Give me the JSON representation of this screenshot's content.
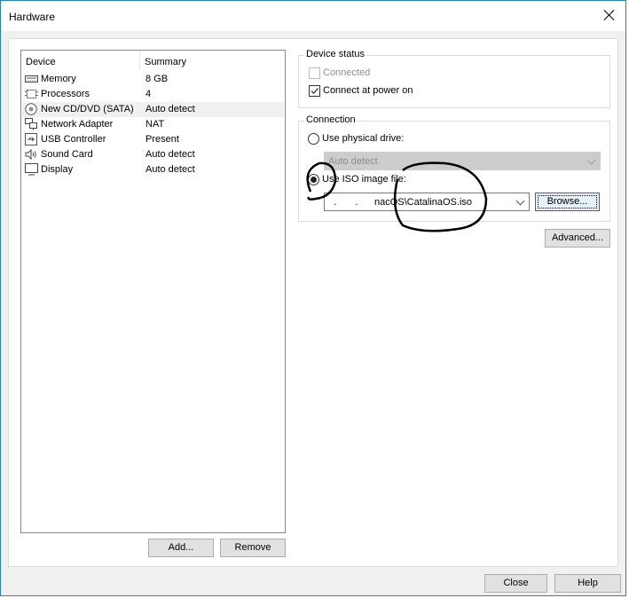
{
  "window": {
    "title": "Hardware"
  },
  "device_list": {
    "columns": [
      "Device",
      "Summary"
    ],
    "rows": [
      {
        "icon": "memory-icon",
        "name": "Memory",
        "summary": "8 GB",
        "selected": false
      },
      {
        "icon": "processor-icon",
        "name": "Processors",
        "summary": "4",
        "selected": false
      },
      {
        "icon": "cd-dvd-icon",
        "name": "New CD/DVD (SATA)",
        "summary": "Auto detect",
        "selected": true
      },
      {
        "icon": "network-adapter-icon",
        "name": "Network Adapter",
        "summary": "NAT",
        "selected": false
      },
      {
        "icon": "usb-icon",
        "name": "USB Controller",
        "summary": "Present",
        "selected": false
      },
      {
        "icon": "speaker-icon",
        "name": "Sound Card",
        "summary": "Auto detect",
        "selected": false
      },
      {
        "icon": "display-icon",
        "name": "Display",
        "summary": "Auto detect",
        "selected": false
      }
    ],
    "add_label": "Add...",
    "remove_label": "Remove"
  },
  "device_status": {
    "legend": "Device status",
    "connected": {
      "label": "Connected",
      "checked": false,
      "disabled": true
    },
    "connect_at_power_on": {
      "label": "Connect at power on",
      "checked": true
    }
  },
  "connection": {
    "legend": "Connection",
    "physical_drive": {
      "label": "Use physical drive:",
      "selected": false,
      "value": "Auto detect"
    },
    "iso_image": {
      "label": "Use ISO image file:",
      "selected": true,
      "value": "  .       .      nacOS\\CatalinaOS.iso"
    },
    "browse_label": "Browse...",
    "advanced_label": "Advanced..."
  },
  "footer": {
    "close_label": "Close",
    "help_label": "Help"
  }
}
